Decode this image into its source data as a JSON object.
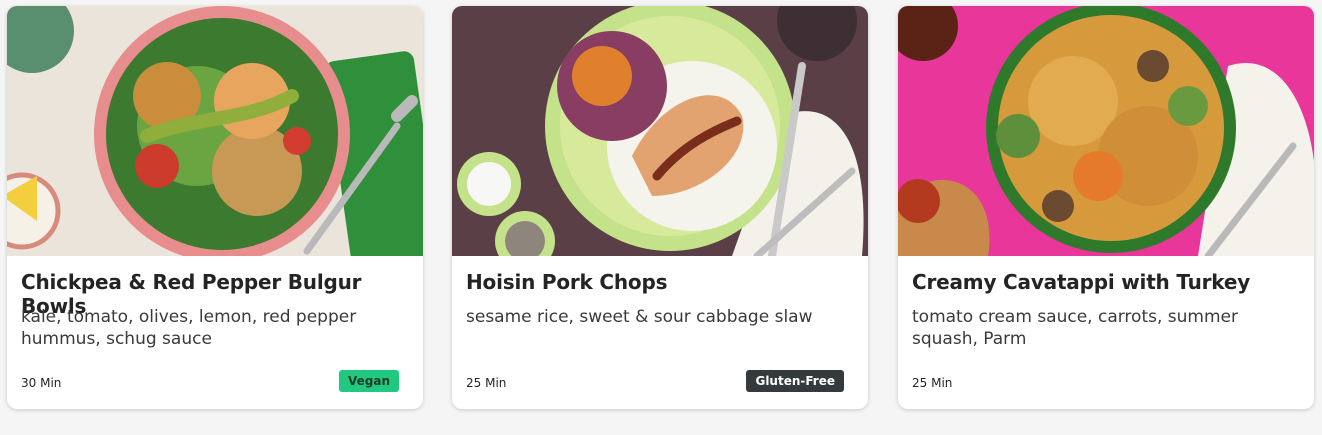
{
  "colors": {
    "page_background": "#f5f5f5",
    "card_background": "#ffffff",
    "vegan_badge": "#20c97f",
    "gluten_free_badge": "#353a3d"
  },
  "recipes": [
    {
      "title": "Chickpea & Red Pepper Bulgur Bowls",
      "description": "kale, tomato, olives, lemon, red pepper hummus, schug sauce",
      "time": "30 Min",
      "badge": "Vegan"
    },
    {
      "title": "Hoisin Pork Chops",
      "description": "sesame rice, sweet & sour cabbage slaw",
      "time": "25 Min",
      "badge": "Gluten-Free"
    },
    {
      "title": "Creamy Cavatappi with Turkey",
      "description": "tomato cream sauce, carrots, summer squash, Parm",
      "time": "25 Min",
      "badge": ""
    }
  ]
}
